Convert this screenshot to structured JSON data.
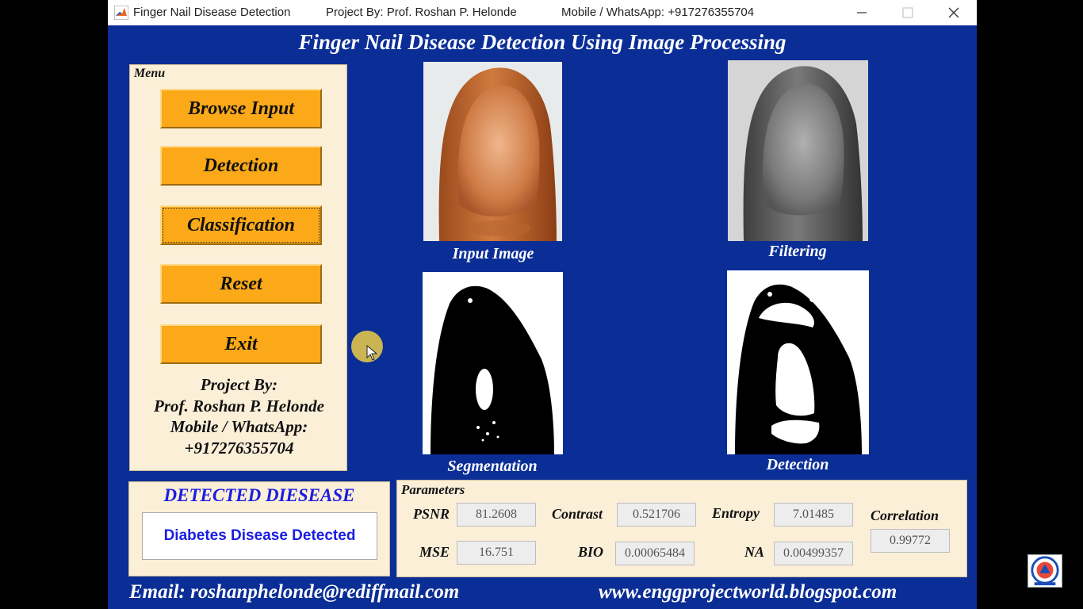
{
  "titlebar": {
    "app_title": "Finger Nail Disease Detection",
    "project": "Project By: Prof. Roshan P. Helonde",
    "mobile": "Mobile / WhatsApp: +917276355704"
  },
  "heading": "Finger Nail Disease Detection Using Image Processing",
  "menu": {
    "legend": "Menu",
    "buttons": [
      "Browse Input",
      "Detection",
      "Classification",
      "Reset",
      "Exit"
    ],
    "credits": [
      "Project By:",
      "Prof. Roshan P. Helonde",
      "Mobile / WhatsApp:",
      "+917276355704"
    ]
  },
  "images": {
    "input_caption": "Input Image",
    "filtering_caption": "Filtering",
    "segmentation_caption": "Segmentation",
    "detection_caption": "Detection"
  },
  "result": {
    "title": "DETECTED DIESEASE",
    "value": "Diabetes Disease Detected"
  },
  "parameters": {
    "legend": "Parameters",
    "psnr_label": "PSNR",
    "psnr_value": "81.2608",
    "contrast_label": "Contrast",
    "contrast_value": "0.521706",
    "entropy_label": "Entropy",
    "entropy_value": "7.01485",
    "correlation_label": "Correlation",
    "correlation_value": "0.99772",
    "mse_label": "MSE",
    "mse_value": "16.751",
    "bio_label": "BIO",
    "bio_value": "0.00065484",
    "na_label": "NA",
    "na_value": "0.00499357"
  },
  "footer": {
    "email": "Email: roshanphelonde@rediffmail.com",
    "website": "www.enggprojectworld.blogspot.com"
  },
  "colors": {
    "background": "#0b2e96",
    "panel": "#fcefd8",
    "button": "#fba918",
    "result_text": "#1a1ee0"
  },
  "icons": [
    "matlab-icon",
    "minimize-icon",
    "maximize-icon",
    "close-icon",
    "mouse-cursor-icon",
    "channel-logo-icon"
  ]
}
